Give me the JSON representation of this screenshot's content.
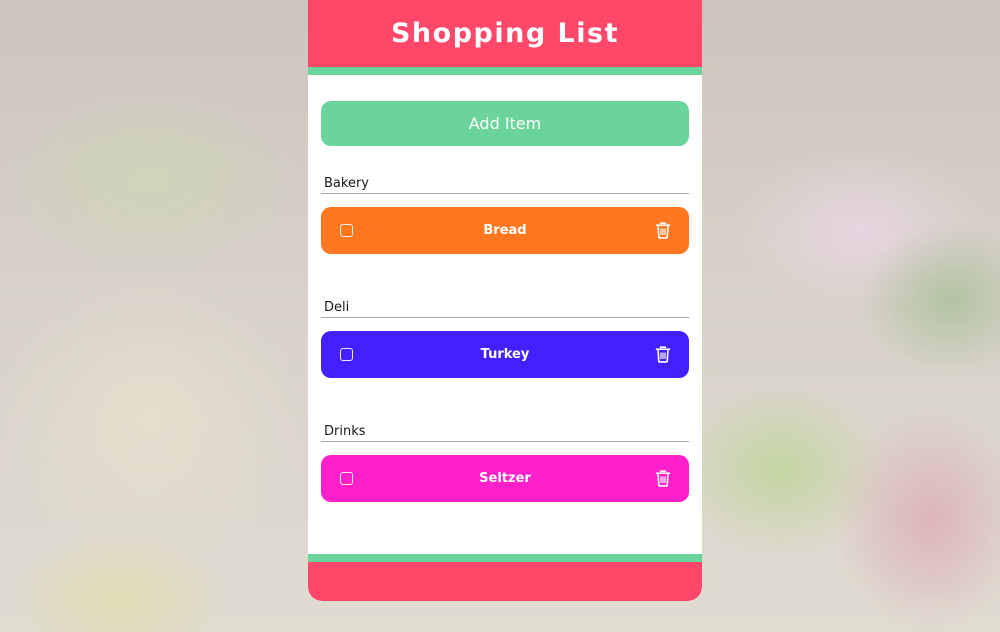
{
  "app": {
    "title": "Shopping List"
  },
  "actions": {
    "add_item_label": "Add Item"
  },
  "colors": {
    "header": "#ff4769",
    "accent": "#6bd49d"
  },
  "categories": [
    {
      "label": "Bakery",
      "items": [
        {
          "name": "Bread",
          "checked": false,
          "color": "#ff771f"
        }
      ]
    },
    {
      "label": "Deli",
      "items": [
        {
          "name": "Turkey",
          "checked": false,
          "color": "#4420ff"
        }
      ]
    },
    {
      "label": "Drinks",
      "items": [
        {
          "name": "Seltzer",
          "checked": false,
          "color": "#ff1fcb"
        }
      ]
    }
  ],
  "icons": {
    "checkbox": "checkbox-unchecked-icon",
    "delete": "trash-icon"
  }
}
